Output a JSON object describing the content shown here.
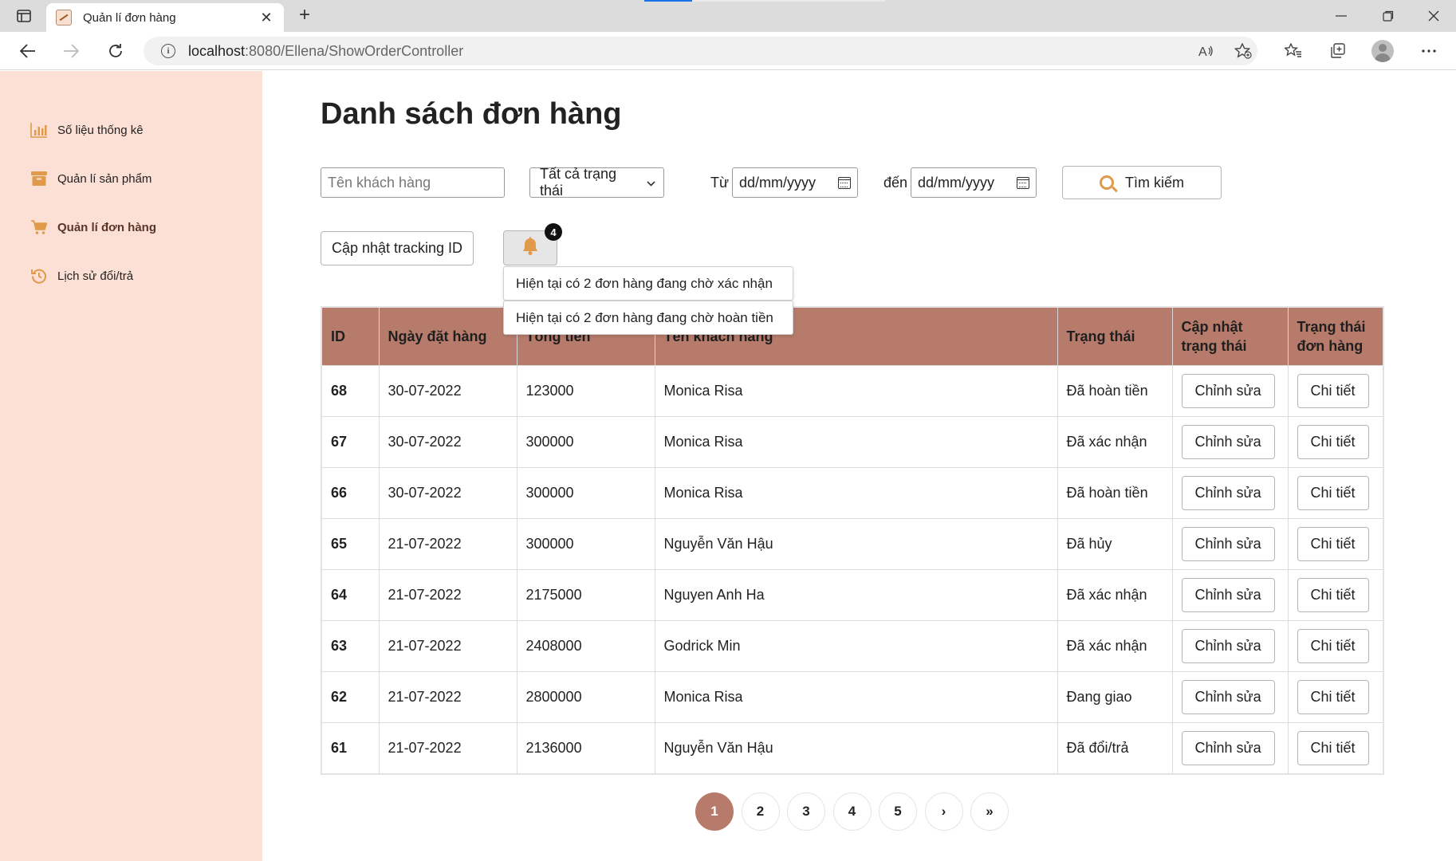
{
  "browser": {
    "tab_title": "Quản lí đơn hàng",
    "url_host": "localhost",
    "url_path": ":8080/Ellena/ShowOrderController"
  },
  "sidebar": {
    "items": [
      {
        "label": "Số liệu thống kê",
        "icon": "bar-chart-icon"
      },
      {
        "label": "Quản lí sản phẩm",
        "icon": "archive-box-icon"
      },
      {
        "label": "Quản lí đơn hàng",
        "icon": "cart-icon",
        "active": true
      },
      {
        "label": "Lịch sử đổi/trả",
        "icon": "history-icon"
      }
    ]
  },
  "main": {
    "title": "Danh sách đơn hàng",
    "filters": {
      "customer_placeholder": "Tên khách hàng",
      "status_selected": "Tất cả trạng thái",
      "from_label": "Từ",
      "to_label": "đến",
      "date_placeholder": "dd/mm/yyyy",
      "search_label": "Tìm kiếm"
    },
    "tracking_button": "Cập nhật tracking ID",
    "notifications": {
      "count": "4",
      "items": [
        "Hiện tại có 2 đơn hàng đang chờ xác nhận",
        "Hiện tại có 2 đơn hàng đang chờ hoàn tiền"
      ]
    },
    "table": {
      "headers": [
        "ID",
        "Ngày đặt hàng",
        "Tổng tiền",
        "Tên khách hàng",
        "Trạng thái",
        "Cập nhật trạng thái",
        "Trạng thái đơn hàng"
      ],
      "edit_label": "Chỉnh sửa",
      "detail_label": "Chi tiết",
      "rows": [
        {
          "id": "68",
          "date": "30-07-2022",
          "total": "123000",
          "customer": "Monica Risa",
          "status": "Đã hoàn tiền"
        },
        {
          "id": "67",
          "date": "30-07-2022",
          "total": "300000",
          "customer": "Monica Risa",
          "status": "Đã xác nhận"
        },
        {
          "id": "66",
          "date": "30-07-2022",
          "total": "300000",
          "customer": "Monica Risa",
          "status": "Đã hoàn tiền"
        },
        {
          "id": "65",
          "date": "21-07-2022",
          "total": "300000",
          "customer": "Nguyễn Văn Hậu",
          "status": "Đã hủy"
        },
        {
          "id": "64",
          "date": "21-07-2022",
          "total": "2175000",
          "customer": "Nguyen Anh Ha",
          "status": "Đã xác nhận"
        },
        {
          "id": "63",
          "date": "21-07-2022",
          "total": "2408000",
          "customer": "Godrick Min",
          "status": "Đã xác nhận"
        },
        {
          "id": "62",
          "date": "21-07-2022",
          "total": "2800000",
          "customer": "Monica Risa",
          "status": "Đang giao"
        },
        {
          "id": "61",
          "date": "21-07-2022",
          "total": "2136000",
          "customer": "Nguyễn Văn Hậu",
          "status": "Đã đổi/trả"
        }
      ]
    },
    "pagination": {
      "pages": [
        "1",
        "2",
        "3",
        "4",
        "5"
      ],
      "active": "1",
      "next": "›",
      "last": "»"
    }
  },
  "colors": {
    "accent": "#b77b6b",
    "sidebar_bg": "#fde0d5",
    "icon_orange": "#e09a4a"
  }
}
